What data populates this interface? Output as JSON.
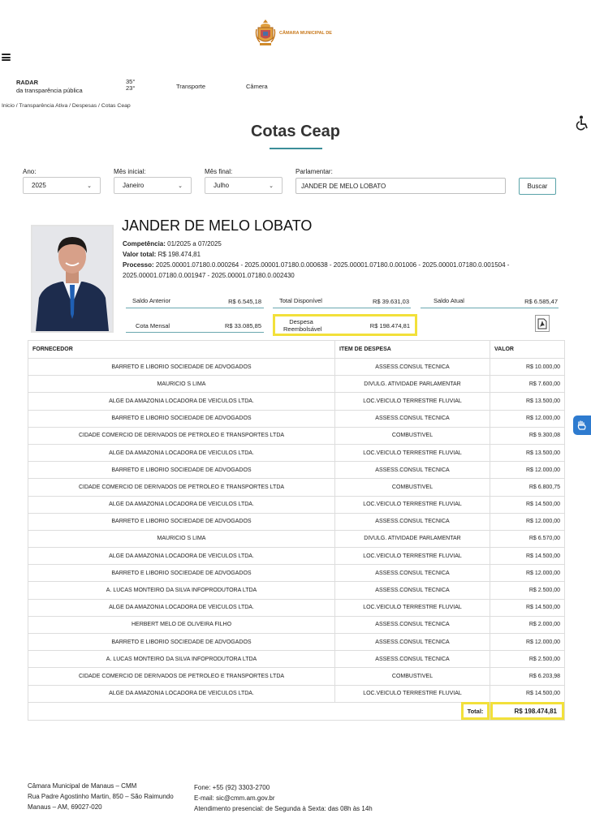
{
  "header": {
    "logo_text": "CÂMARA MUNICIPAL DE",
    "radar_title": "RADAR",
    "radar_subtitle": "da transparência pública",
    "temp_high": "35°",
    "temp_low": "23°",
    "nav": [
      "Transporte",
      "Câmera"
    ],
    "breadcrumb": "Inicio / Transparência Ativa / Despesas / Cotas Ceap"
  },
  "page_title": "Cotas Ceap",
  "filters": {
    "ano_label": "Ano:",
    "ano_value": "2025",
    "mes_inicial_label": "Mês inicial:",
    "mes_inicial_value": "Janeiro",
    "mes_final_label": "Mês final:",
    "mes_final_value": "Julho",
    "parlamentar_label": "Parlamentar:",
    "parlamentar_value": "JANDER DE MELO LOBATO",
    "search_button": "Buscar"
  },
  "profile": {
    "name": "JANDER DE MELO LOBATO",
    "competencia_label": "Competência:",
    "competencia_value": "01/2025 a 07/2025",
    "valor_total_label": "Valor total:",
    "valor_total_value": "R$ 198.474,81",
    "processo_label": "Processo:",
    "processo_line1": "2025.00001.07180.0.000264 - 2025.00001.07180.0.000638 - 2025.00001.07180.0.001006 - 2025.00001.07180.0.001504 -",
    "processo_line2": "2025.00001.07180.0.001947 - 2025.00001.07180.0.002430"
  },
  "stats": {
    "saldo_anterior_label": "Saldo Anterior",
    "saldo_anterior_value": "R$ 6.545,18",
    "total_disponivel_label": "Total Disponível",
    "total_disponivel_value": "R$ 39.631,03",
    "saldo_atual_label": "Saldo Atual",
    "saldo_atual_value": "R$ 6.585,47",
    "cota_mensal_label": "Cota Mensal",
    "cota_mensal_value": "R$ 33.085,85",
    "despesa_label_1": "Despesa",
    "despesa_label_2": "Reembolsável",
    "despesa_value": "R$ 198.474,81"
  },
  "table": {
    "headers": [
      "FORNECEDOR",
      "ITEM DE DESPESA",
      "VALOR"
    ],
    "rows": [
      [
        "BARRETO E LIBORIO SOCIEDADE DE ADVOGADOS",
        "ASSESS.CONSUL TECNICA",
        "R$ 10.000,00"
      ],
      [
        "MAURICIO S LIMA",
        "DIVULG. ATIVIDADE PARLAMENTAR",
        "R$ 7.600,00"
      ],
      [
        "ALGE DA AMAZONIA LOCADORA DE VEICULOS LTDA.",
        "LOC.VEICULO TERRESTRE FLUVIAL",
        "R$ 13.500,00"
      ],
      [
        "BARRETO E LIBORIO SOCIEDADE DE ADVOGADOS",
        "ASSESS.CONSUL TECNICA",
        "R$ 12.000,00"
      ],
      [
        "CIDADE COMERCIO DE DERIVADOS DE PETROLEO E TRANSPORTES LTDA",
        "COMBUSTIVEL",
        "R$ 9.300,08"
      ],
      [
        "ALGE DA AMAZONIA LOCADORA DE VEICULOS LTDA.",
        "LOC.VEICULO TERRESTRE FLUVIAL",
        "R$ 13.500,00"
      ],
      [
        "BARRETO E LIBORIO SOCIEDADE DE ADVOGADOS",
        "ASSESS.CONSUL TECNICA",
        "R$ 12.000,00"
      ],
      [
        "CIDADE COMERCIO DE DERIVADOS DE PETROLEO E TRANSPORTES LTDA",
        "COMBUSTIVEL",
        "R$ 6.800,75"
      ],
      [
        "ALGE DA AMAZONIA LOCADORA DE VEICULOS LTDA.",
        "LOC.VEICULO TERRESTRE FLUVIAL",
        "R$ 14.500,00"
      ],
      [
        "BARRETO E LIBORIO SOCIEDADE DE ADVOGADOS",
        "ASSESS.CONSUL TECNICA",
        "R$ 12.000,00"
      ],
      [
        "MAURICIO S LIMA",
        "DIVULG. ATIVIDADE PARLAMENTAR",
        "R$ 6.570,00"
      ],
      [
        "ALGE DA AMAZONIA LOCADORA DE VEICULOS LTDA.",
        "LOC.VEICULO TERRESTRE FLUVIAL",
        "R$ 14.500,00"
      ],
      [
        "BARRETO E LIBORIO SOCIEDADE DE ADVOGADOS",
        "ASSESS.CONSUL TECNICA",
        "R$ 12.000,00"
      ],
      [
        "A. LUCAS MONTEIRO DA SILVA INFOPRODUTORA LTDA",
        "ASSESS.CONSUL TECNICA",
        "R$ 2.500,00"
      ],
      [
        "ALGE DA AMAZONIA LOCADORA DE VEICULOS LTDA.",
        "LOC.VEICULO TERRESTRE FLUVIAL",
        "R$ 14.500,00"
      ],
      [
        "HERBERT MELO DE OLIVEIRA FILHO",
        "ASSESS.CONSUL TECNICA",
        "R$ 2.000,00"
      ],
      [
        "BARRETO E LIBORIO SOCIEDADE DE ADVOGADOS",
        "ASSESS.CONSUL TECNICA",
        "R$ 12.000,00"
      ],
      [
        "A. LUCAS MONTEIRO DA SILVA INFOPRODUTORA LTDA",
        "ASSESS.CONSUL TECNICA",
        "R$ 2.500,00"
      ],
      [
        "CIDADE COMERCIO DE DERIVADOS DE PETROLEO E TRANSPORTES LTDA",
        "COMBUSTIVEL",
        "R$ 6.203,98"
      ],
      [
        "ALGE DA AMAZONIA LOCADORA DE VEICULOS LTDA.",
        "LOC.VEICULO TERRESTRE FLUVIAL",
        "R$ 14.500,00"
      ]
    ],
    "total_label": "Total:",
    "total_value": "R$ 198.474,81"
  },
  "footer": {
    "org": "Câmara Municipal de Manaus – CMM",
    "address1": "Rua Padre Agostinho Martin, 850 – São Raimundo",
    "address2": "Manaus – AM, 69027-020",
    "phone": "Fone: +55 (92) 3303-2700",
    "email": "E-mail: sic@cmm.am.gov.br",
    "hours": "Atendimento presencial: de Segunda à Sexta: das 08h às 14h"
  },
  "colors": {
    "accent": "#3c8e99",
    "highlight": "#f2e03a",
    "logo": "#c8791c"
  }
}
